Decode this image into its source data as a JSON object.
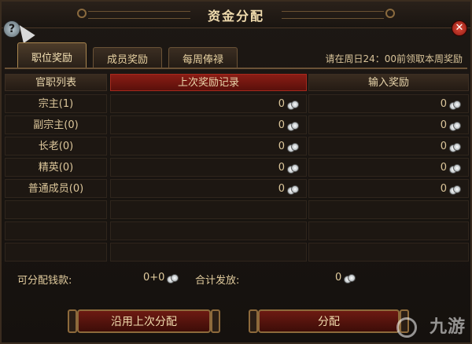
{
  "window": {
    "title": "资金分配",
    "help_glyph": "?",
    "close_glyph": "✕"
  },
  "tabs": [
    {
      "label": "职位奖励",
      "active": true
    },
    {
      "label": "成员奖励",
      "active": false
    },
    {
      "label": "每周俸禄",
      "active": false
    }
  ],
  "notice": "请在周日24：00前领取本周奖励",
  "table": {
    "headers": [
      "官职列表",
      "上次奖励记录",
      "输入奖励"
    ],
    "rows": [
      {
        "rank": "宗主(1)",
        "last": "0",
        "input": "0"
      },
      {
        "rank": "副宗主(0)",
        "last": "0",
        "input": "0"
      },
      {
        "rank": "长老(0)",
        "last": "0",
        "input": "0"
      },
      {
        "rank": "精英(0)",
        "last": "0",
        "input": "0"
      },
      {
        "rank": "普通成员(0)",
        "last": "0",
        "input": "0"
      },
      {
        "rank": "",
        "last": "",
        "input": ""
      },
      {
        "rank": "",
        "last": "",
        "input": ""
      },
      {
        "rank": "",
        "last": "",
        "input": ""
      }
    ]
  },
  "totals": {
    "available_label": "可分配钱款:",
    "available_value": "0+0",
    "total_label": "合计发放:",
    "total_value": "0"
  },
  "buttons": {
    "reuse": "沿用上次分配",
    "distribute": "分配"
  },
  "watermark": "九游",
  "colors": {
    "accent_red": "#8a1d15",
    "gold_text": "#f1dcae",
    "panel_bg": "#1d1712"
  }
}
